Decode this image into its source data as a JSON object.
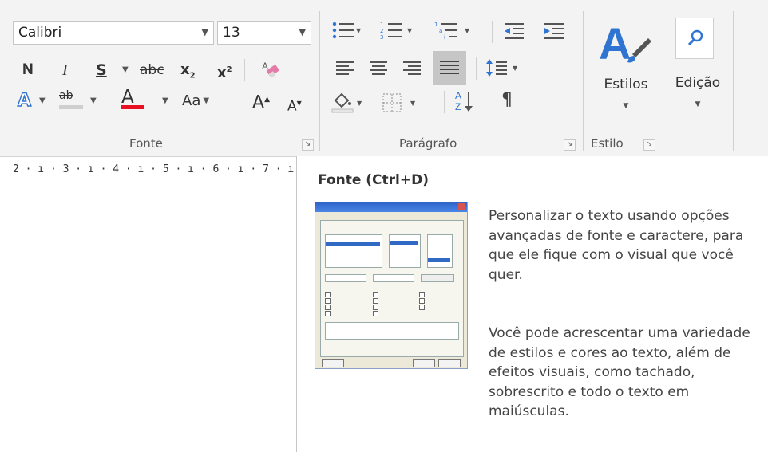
{
  "ribbon": {
    "font": {
      "font_name": "Calibri",
      "font_size": "13",
      "bold": "N",
      "italic": "I",
      "underline": "S",
      "strike": "abc",
      "subscript": "x",
      "subscript_mark": "2",
      "superscript": "x",
      "superscript_mark": "2",
      "text_effects": "A",
      "highlight": "ab",
      "font_color": "A",
      "font_color_hex": "#e81123",
      "change_case": "Aa",
      "grow_font": "A",
      "shrink_font": "A",
      "group_label": "Fonte"
    },
    "paragraph": {
      "sort": "A\nZ",
      "pilcrow": "¶",
      "group_label": "Parágrafo"
    },
    "styles": {
      "button_label": "Estilos",
      "group_label": "Estilo"
    },
    "editing": {
      "button_label": "Edição"
    }
  },
  "ruler": {
    "text": "2 · ı · 3 · ı · 4 · ı · 5 · ı · 6 · ı · 7 · ı ·"
  },
  "tooltip": {
    "title": "Fonte (Ctrl+D)",
    "paragraph1": "Personalizar o texto usando opções avançadas de fonte e caractere, para que ele fique com o visual que você quer.",
    "paragraph2": "Você pode acrescentar uma variedade de estilos e cores ao texto, além de efeitos visuais, como tachado, sobrescrito e todo o texto em maiúsculas."
  }
}
